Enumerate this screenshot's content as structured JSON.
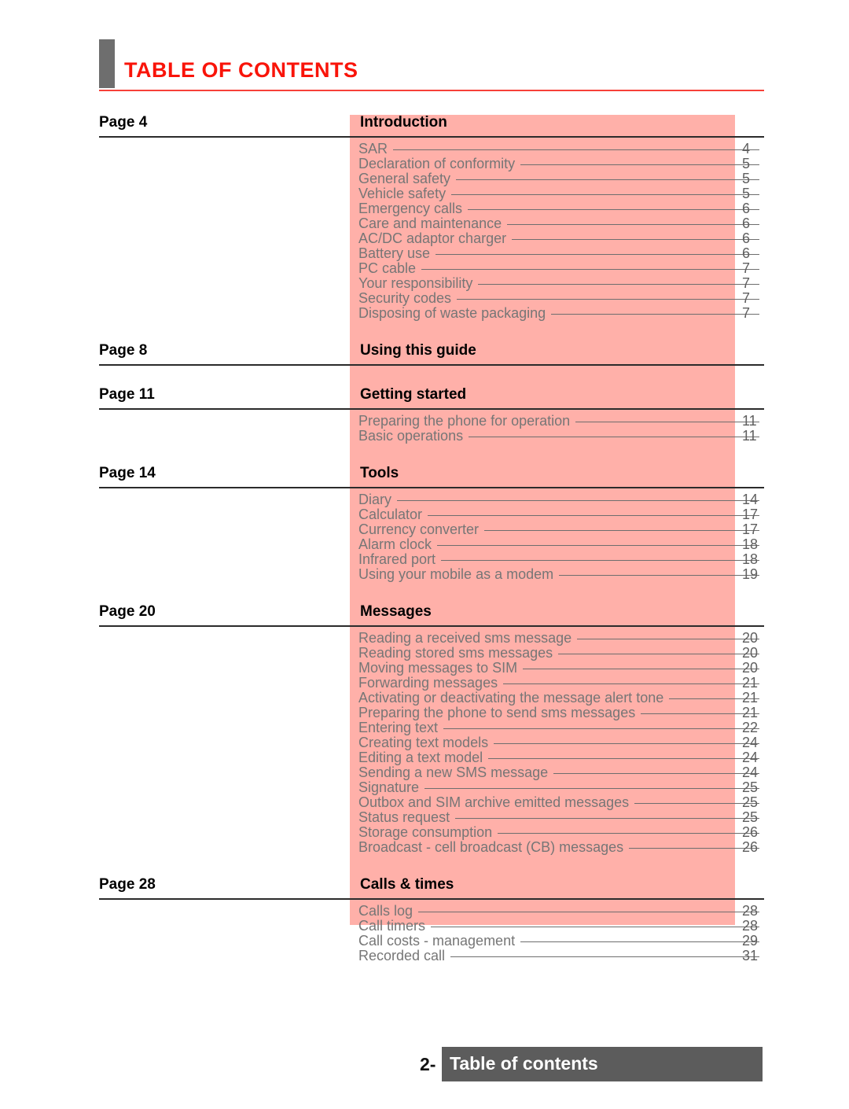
{
  "header": {
    "title": "TABLE OF CONTENTS",
    "accent_color": "#f91409",
    "rule_color": "#f74039",
    "bar_color": "#6e6e6e"
  },
  "highlight": {
    "color": "#ffb0a9"
  },
  "toc": {
    "sections": [
      {
        "page_label": "Page 4",
        "title": "Introduction",
        "entries": [
          {
            "label": "SAR",
            "page": "4"
          },
          {
            "label": "Declaration of conformity",
            "page": "5"
          },
          {
            "label": "General safety",
            "page": "5"
          },
          {
            "label": "Vehicle safety",
            "page": "5"
          },
          {
            "label": "Emergency calls",
            "page": "6"
          },
          {
            "label": "Care and maintenance",
            "page": "6"
          },
          {
            "label": "AC/DC adaptor charger",
            "page": "6"
          },
          {
            "label": "Battery use",
            "page": "6"
          },
          {
            "label": "PC cable",
            "page": "7"
          },
          {
            "label": "Your responsibility",
            "page": "7"
          },
          {
            "label": "Security codes",
            "page": "7"
          },
          {
            "label": "Disposing of waste packaging",
            "page": "7"
          }
        ]
      },
      {
        "page_label": "Page 8",
        "title": "Using this guide",
        "entries": []
      },
      {
        "page_label": "Page 11",
        "title": "Getting started",
        "entries": [
          {
            "label": "Preparing the phone for operation",
            "page": "11"
          },
          {
            "label": "Basic operations",
            "page": "11"
          }
        ]
      },
      {
        "page_label": "Page 14",
        "title": "Tools",
        "entries": [
          {
            "label": "Diary",
            "page": "14"
          },
          {
            "label": "Calculator",
            "page": "17"
          },
          {
            "label": "Currency converter",
            "page": "17"
          },
          {
            "label": "Alarm clock",
            "page": "18"
          },
          {
            "label": "Infrared port",
            "page": "18"
          },
          {
            "label": "Using your mobile as a modem",
            "page": "19"
          }
        ]
      },
      {
        "page_label": "Page 20",
        "title": "Messages",
        "entries": [
          {
            "label": "Reading a received sms message",
            "page": "20"
          },
          {
            "label": "Reading stored sms messages",
            "page": "20"
          },
          {
            "label": "Moving messages to SIM",
            "page": "20"
          },
          {
            "label": "Forwarding messages",
            "page": "21"
          },
          {
            "label": "Activating or deactivating the message alert tone",
            "page": "21"
          },
          {
            "label": "Preparing the phone to send sms messages",
            "page": "21"
          },
          {
            "label": "Entering text",
            "page": "22"
          },
          {
            "label": "Creating text models",
            "page": "24"
          },
          {
            "label": "Editing a text model",
            "page": "24"
          },
          {
            "label": "Sending a new SMS message",
            "page": "24"
          },
          {
            "label": "Signature",
            "page": "25"
          },
          {
            "label": "Outbox and SIM archive emitted messages",
            "page": "25"
          },
          {
            "label": "Status request",
            "page": "25"
          },
          {
            "label": "Storage consumption",
            "page": "26"
          },
          {
            "label": "Broadcast - cell broadcast (CB) messages",
            "page": "26"
          }
        ]
      },
      {
        "page_label": "Page 28",
        "title": "Calls & times",
        "entries": [
          {
            "label": "Calls log",
            "page": "28"
          },
          {
            "label": "Call timers",
            "page": "28"
          },
          {
            "label": "Call costs - management",
            "page": "29"
          },
          {
            "label": "Recorded call",
            "page": "31"
          }
        ]
      }
    ]
  },
  "footer": {
    "number": "2-",
    "label": "Table of contents",
    "band_color": "#5c5c5c"
  }
}
